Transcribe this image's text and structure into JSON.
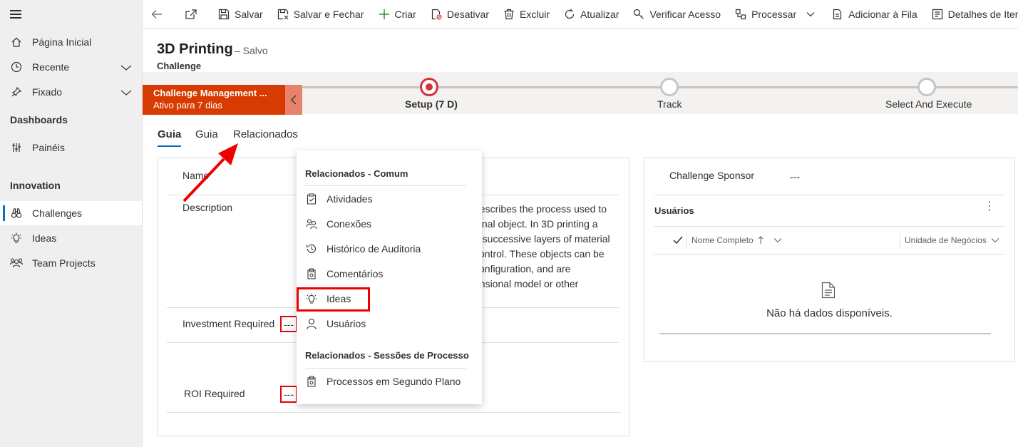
{
  "sidebar": {
    "items": [
      {
        "label": "Página Inicial",
        "icon": "home-icon"
      },
      {
        "label": "Recente",
        "icon": "clock-icon"
      },
      {
        "label": "Fixado",
        "icon": "pin-icon"
      }
    ],
    "dashboards_heading": "Dashboards",
    "paineis_label": "Painéis",
    "innovation_heading": "Innovation",
    "innovation_items": [
      {
        "label": "Challenges",
        "icon": "binoculars-icon",
        "active": true
      },
      {
        "label": "Ideas",
        "icon": "lightbulb-icon"
      },
      {
        "label": "Team Projects",
        "icon": "team-icon"
      }
    ]
  },
  "toolbar": {
    "save": "Salvar",
    "save_close": "Salvar e Fechar",
    "create": "Criar",
    "deactivate": "Desativar",
    "delete": "Excluir",
    "refresh": "Atualizar",
    "check_access": "Verificar Acesso",
    "process": "Processar",
    "add_queue": "Adicionar à Fila",
    "item_details": "Detalhes de Item"
  },
  "record": {
    "title": "3D Printing",
    "status": "– Salvo",
    "entity": "Challenge"
  },
  "bpf": {
    "name": "Challenge Management ...",
    "duration": "Ativo para 7 dias",
    "stages": [
      "Setup  (7 D)",
      "Track",
      "Select And Execute"
    ],
    "accent": "#d83b01"
  },
  "tabs": [
    "Guia",
    "Guia",
    "Relacionados"
  ],
  "form": {
    "name_label": "Name",
    "description_label": "Description",
    "description_lines": [
      "describes the process used to",
      "ional object. In 3D printing a",
      "d successive layers of material",
      "control. These objects can be",
      "configuration, and are",
      "ensional model or other"
    ],
    "investment_label": "Investment Required",
    "investment_value": "---",
    "roi_label": "ROI Required",
    "roi_value": "---"
  },
  "right": {
    "sponsor_label": "Challenge Sponsor",
    "sponsor_value": "---",
    "users_title": "Usuários",
    "col_name": "Nome Completo",
    "col_unit": "Unidade de Negócios",
    "empty_text": "Não há dados disponíveis."
  },
  "menu": {
    "heading_common": "Relacionados - Comum",
    "items": [
      "Atividades",
      "Conexões",
      "Histórico de Auditoria",
      "Comentários",
      "Ideas",
      "Usuários"
    ],
    "heading_sessions": "Relacionados - Sessões de Processo",
    "session_items": [
      "Processos em Segundo Plano"
    ]
  }
}
